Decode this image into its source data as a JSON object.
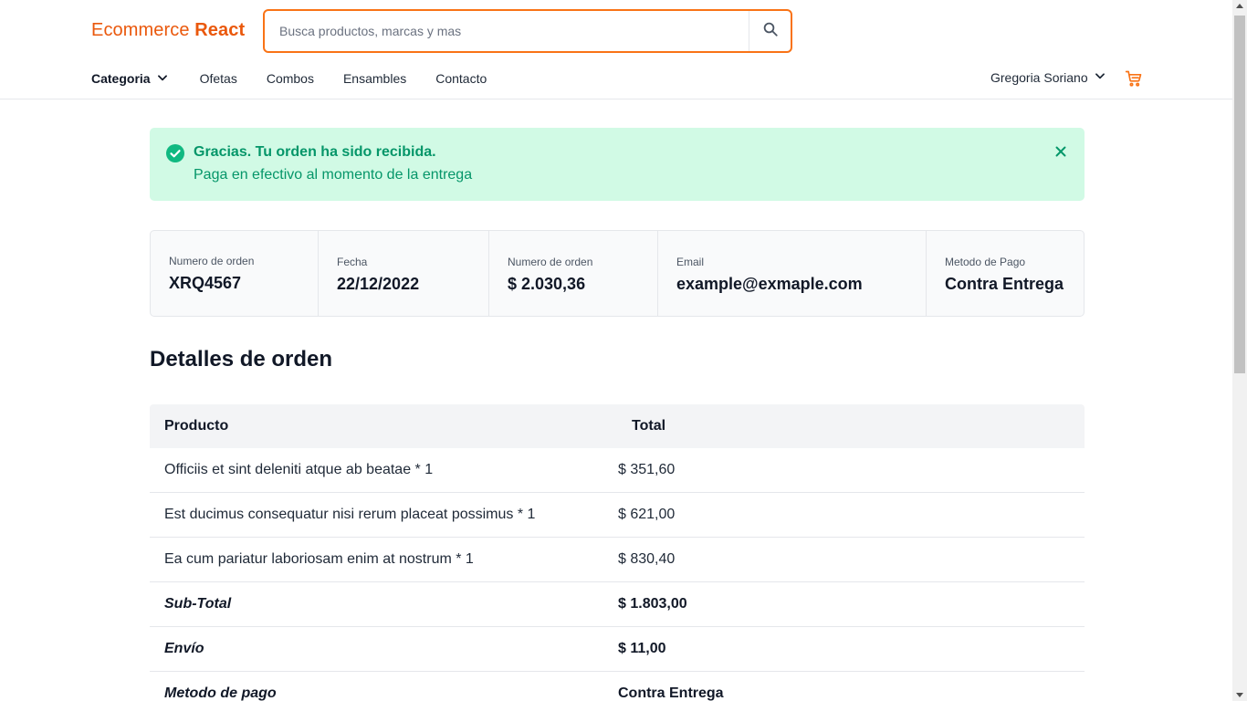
{
  "header": {
    "logo_main": "Ecommerce ",
    "logo_bold": "React",
    "search_placeholder": "Busca productos, marcas y mas",
    "search_icon": "search-icon",
    "nav": {
      "category_label": "Categoria",
      "links": [
        "Ofetas",
        "Combos",
        "Ensambles",
        "Contacto"
      ]
    },
    "user_name": "Gregoria Soriano",
    "cart_icon": "cart-icon"
  },
  "alert": {
    "title": "Gracias. Tu orden ha sido recibida.",
    "message": "Paga en efectivo al momento de la entrega",
    "bg_color": "#d1fae5",
    "text_color": "#059669"
  },
  "summary": [
    {
      "label": "Numero de orden",
      "value": "XRQ4567"
    },
    {
      "label": "Fecha",
      "value": "22/12/2022"
    },
    {
      "label": "Numero de orden",
      "value": "$ 2.030,36"
    },
    {
      "label": "Email",
      "value": "example@exmaple.com"
    },
    {
      "label": "Metodo de Pago",
      "value": "Contra Entrega"
    }
  ],
  "details": {
    "title": "Detalles de orden",
    "columns": [
      "Producto",
      "Total"
    ],
    "items": [
      {
        "name": "Officiis et sint deleniti atque ab beatae * 1",
        "total": "$ 351,60"
      },
      {
        "name": "Est ducimus consequatur nisi rerum placeat possimus * 1",
        "total": "$ 621,00"
      },
      {
        "name": "Ea cum pariatur laboriosam enim at nostrum * 1",
        "total": "$ 830,40"
      }
    ],
    "subtotal_label": "Sub-Total",
    "subtotal_value": "$ 1.803,00",
    "shipping_label": "Envío",
    "shipping_value": "$ 11,00",
    "payment_label": "Metodo de pago",
    "payment_value": "Contra Entrega"
  },
  "colors": {
    "accent": "#f97316",
    "logo": "#ea580c"
  }
}
